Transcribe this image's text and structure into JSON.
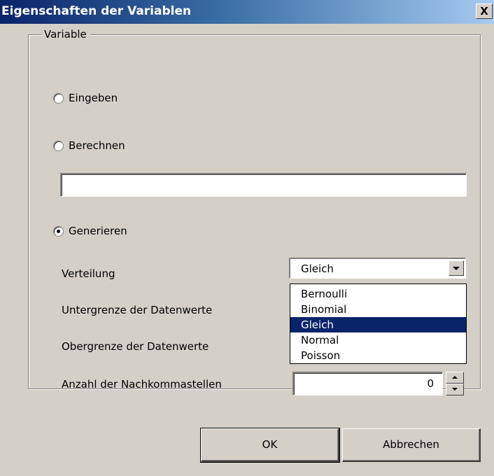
{
  "window": {
    "title": "Eigenschaften der Variablen",
    "close_label": "X"
  },
  "group": {
    "legend": "Variable"
  },
  "radios": {
    "eingeben": "Eingeben",
    "berechnen": "Berechnen",
    "generieren": "Generieren",
    "selected": "generieren"
  },
  "formula_input": {
    "value": ""
  },
  "generate": {
    "distribution_label": "Verteilung",
    "distribution_value": "Gleich",
    "distribution_options": [
      "Bernoulli",
      "Binomial",
      "Gleich",
      "Normal",
      "Poisson"
    ],
    "lower_label": "Untergrenze der Datenwerte",
    "upper_label": "Obergrenze der Datenwerte",
    "decimals_label": "Anzahl der Nachkommastellen",
    "decimals_value": "0"
  },
  "buttons": {
    "ok": "OK",
    "cancel": "Abbrechen"
  },
  "colors": {
    "title_start": "#0a246a",
    "title_end": "#a6caf0",
    "face": "#d4d0c8",
    "selection": "#0a246a"
  }
}
